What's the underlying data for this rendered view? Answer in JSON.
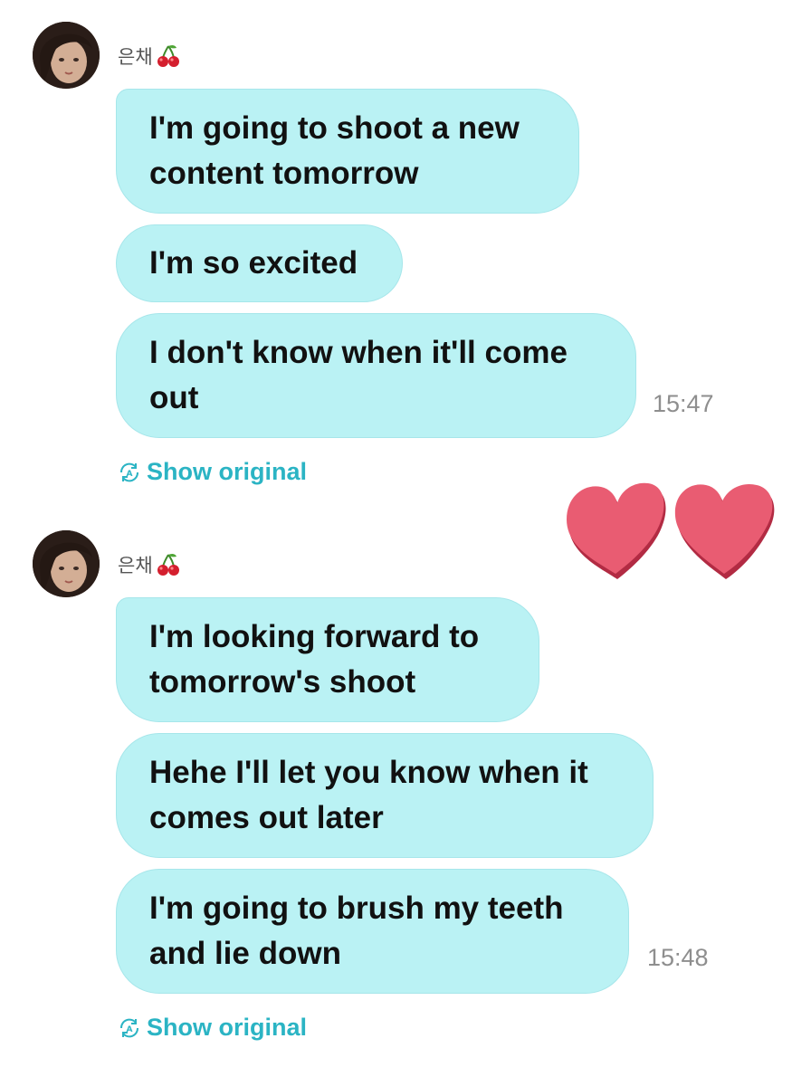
{
  "conversation": [
    {
      "sender_name": "은채",
      "sender_emoji": "🍒",
      "messages": [
        {
          "line1": "I'm going to shoot a new",
          "line2": "content tomorrow"
        },
        {
          "line1": "I'm so excited",
          "line2": ""
        },
        {
          "line1": "I don't know when it'll come",
          "line2": "out"
        }
      ],
      "timestamp": "15:47",
      "show_original_label": "Show original"
    },
    {
      "sender_name": "은채",
      "sender_emoji": "🍒",
      "messages": [
        {
          "line1": "I'm looking forward to",
          "line2": "tomorrow's shoot"
        },
        {
          "line1": "Hehe I'll let you know when it",
          "line2": "comes out later"
        },
        {
          "line1": "I'm going to brush my teeth",
          "line2": "and lie down"
        }
      ],
      "timestamp": "15:48",
      "show_original_label": "Show original"
    }
  ],
  "reaction": {
    "icon": "two-hearts-sticker",
    "color": "#e95c72"
  },
  "colors": {
    "bubble_bg": "#baf2f4",
    "bubble_border": "#a6e6ea",
    "link": "#2bb4c4",
    "timestamp": "#8e8e8e"
  },
  "icons": {
    "avatar": "profile-photo",
    "cherry": "cherry-emoji",
    "translate": "translate-icon"
  }
}
